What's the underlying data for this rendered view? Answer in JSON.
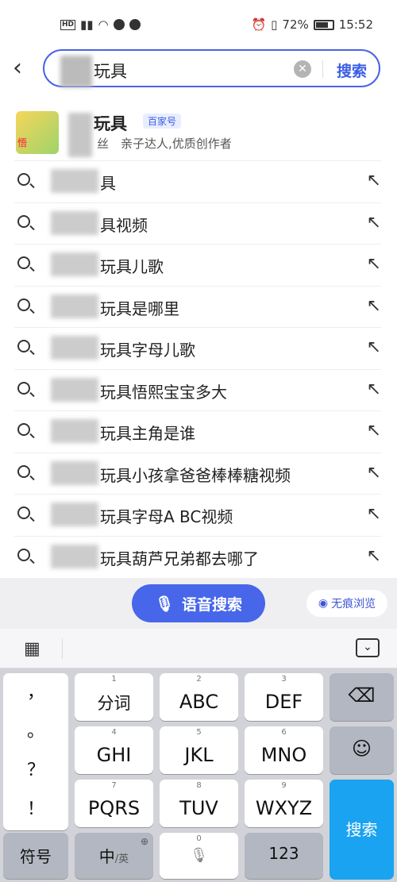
{
  "status_bar": {
    "hd": "HD",
    "battery": "72%",
    "time": "15:52"
  },
  "search": {
    "query": "玩具",
    "submit_label": "搜索"
  },
  "account": {
    "logo_text": "悟",
    "name": "玩具",
    "badge": "百家号",
    "desc_prefix": "丝",
    "desc": "亲子达人,优质创作者"
  },
  "suggestions": [
    {
      "text": "具"
    },
    {
      "text": "具视频"
    },
    {
      "text": "玩具儿歌"
    },
    {
      "text": "玩具是哪里"
    },
    {
      "text": "玩具字母儿歌"
    },
    {
      "text": "玩具悟熙宝宝多大"
    },
    {
      "text": "玩具主角是谁"
    },
    {
      "text": "玩具小孩拿爸爸棒棒糖视频"
    },
    {
      "text": "玩具字母A BC视频"
    },
    {
      "text": "玩具葫芦兄弟都去哪了"
    }
  ],
  "voice_search_label": "语音搜索",
  "incognito_label": "无痕浏览",
  "keyboard": {
    "punct": [
      "，",
      "。",
      "？",
      "！"
    ],
    "keys": [
      {
        "num": "1",
        "label": "分词"
      },
      {
        "num": "2",
        "label": "ABC"
      },
      {
        "num": "3",
        "label": "DEF"
      },
      {
        "num": "4",
        "label": "GHI"
      },
      {
        "num": "5",
        "label": "JKL"
      },
      {
        "num": "6",
        "label": "MNO"
      },
      {
        "num": "7",
        "label": "PQRS"
      },
      {
        "num": "8",
        "label": "TUV"
      },
      {
        "num": "9",
        "label": "WXYZ"
      }
    ],
    "symbols_label": "符号",
    "lang_main": "中",
    "lang_sub": "/英",
    "space_num": "0",
    "num_label": "123",
    "search_label": "搜索"
  }
}
